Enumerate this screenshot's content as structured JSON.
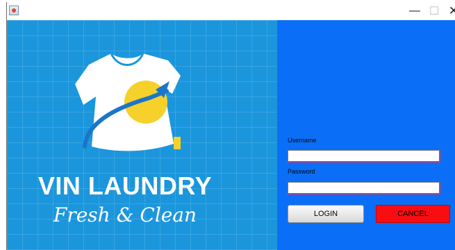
{
  "window": {
    "app_icon": "java-coffee-icon",
    "minimize_glyph": "—",
    "maximize_glyph": "☐",
    "close_glyph": "✕"
  },
  "brand": {
    "title": "VIN LAUNDRY",
    "tagline": "Fresh & Clean",
    "logo_icon": "tshirt-arrow-logo"
  },
  "login": {
    "username_label": "Username",
    "username_value": "",
    "password_label": "Password",
    "password_value": "",
    "login_button": "LOGIN",
    "cancel_button": "CANCEL"
  },
  "colors": {
    "left_panel_bg": "#1b96dc",
    "right_panel_bg": "#0a6ff6",
    "cancel_bg": "#f80d10",
    "logo_circle": "#f6d12b",
    "logo_arrow": "#1a76c9"
  }
}
